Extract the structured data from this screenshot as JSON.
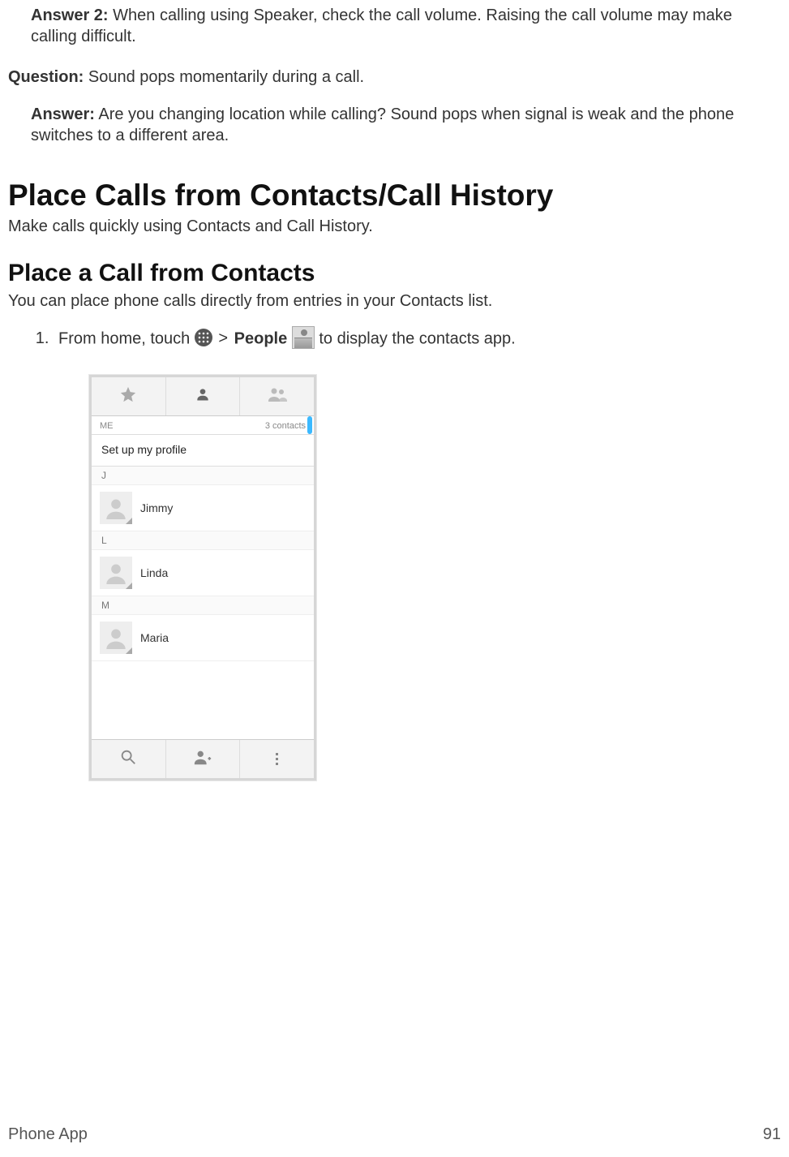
{
  "answer2": {
    "label": "Answer 2:",
    "text": " When calling using Speaker, check the call volume. Raising the call volume may make calling difficult."
  },
  "question": {
    "label": "Question:",
    "text": " Sound pops momentarily during a call."
  },
  "answer": {
    "label": "Answer:",
    "text": " Are you changing location while calling? Sound pops when signal is weak and the phone switches to a different area."
  },
  "h1": "Place Calls from Contacts/Call History",
  "h1_sub": "Make calls quickly using Contacts and Call History.",
  "h2": "Place a Call from Contacts",
  "h2_sub": "You can place phone calls directly from entries in your Contacts list.",
  "step1": {
    "pre": "From home, touch ",
    "gt": ">",
    "people_bold": "People",
    "post": " to display the contacts app."
  },
  "shot": {
    "me_label": "ME",
    "contacts_count": "3 contacts",
    "setup_profile": "Set up my profile",
    "sections": [
      {
        "letter": "J",
        "name": "Jimmy"
      },
      {
        "letter": "L",
        "name": "Linda"
      },
      {
        "letter": "M",
        "name": "Maria"
      }
    ]
  },
  "footer": {
    "left": "Phone App",
    "right": "91"
  }
}
